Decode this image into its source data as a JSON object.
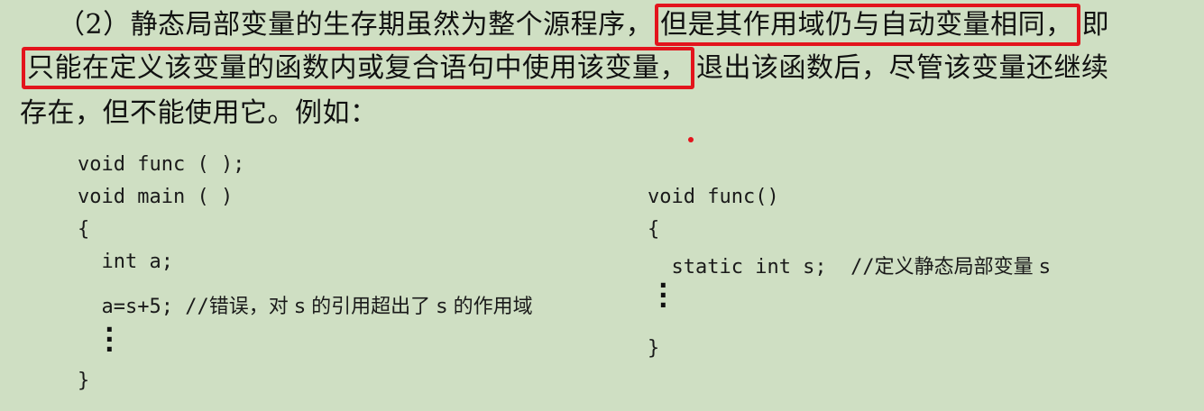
{
  "paragraph": {
    "line1_prefix": "（2）静态局部变量的生存期虽然为整个源程序，",
    "line1_highlight": "但是其作用域仍与自动变量相同，",
    "line1_suffix": "即",
    "line2_highlight": "只能在定义该变量的函数内或复合语句中使用该变量，",
    "line2_suffix": "退出该函数后，尽管该变量还继续",
    "line3": "存在，但不能使用它。例如："
  },
  "code_left": {
    "line1": "void func ( );",
    "line2": "void main ( )",
    "line3": "{",
    "line4": "  int a;",
    "line5_code": "  a=s+5; //",
    "line5_comment": "错误，对 s 的引用超出了 s 的作用域",
    "line6": "}"
  },
  "code_right": {
    "line1": "void func()",
    "line2": "{",
    "line3_code": "  static int s;  //",
    "line3_comment": "定义静态局部变量 s",
    "line4": "}"
  },
  "colors": {
    "background": "#cfdfc3",
    "highlight_border": "#e3141c"
  }
}
